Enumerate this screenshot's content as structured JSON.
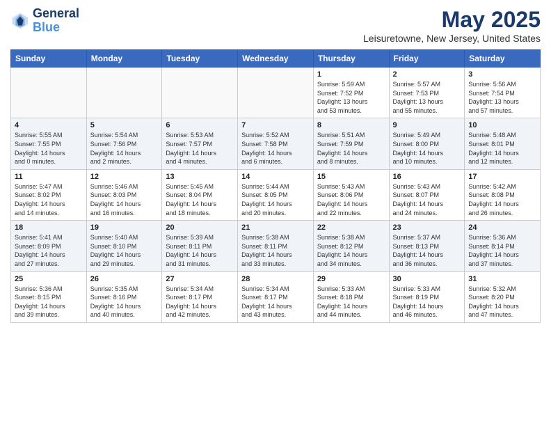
{
  "header": {
    "logo_line1": "General",
    "logo_line2": "Blue",
    "title": "May 2025",
    "subtitle": "Leisuretowne, New Jersey, United States"
  },
  "weekdays": [
    "Sunday",
    "Monday",
    "Tuesday",
    "Wednesday",
    "Thursday",
    "Friday",
    "Saturday"
  ],
  "weeks": [
    [
      {
        "day": "",
        "info": ""
      },
      {
        "day": "",
        "info": ""
      },
      {
        "day": "",
        "info": ""
      },
      {
        "day": "",
        "info": ""
      },
      {
        "day": "1",
        "info": "Sunrise: 5:59 AM\nSunset: 7:52 PM\nDaylight: 13 hours\nand 53 minutes."
      },
      {
        "day": "2",
        "info": "Sunrise: 5:57 AM\nSunset: 7:53 PM\nDaylight: 13 hours\nand 55 minutes."
      },
      {
        "day": "3",
        "info": "Sunrise: 5:56 AM\nSunset: 7:54 PM\nDaylight: 13 hours\nand 57 minutes."
      }
    ],
    [
      {
        "day": "4",
        "info": "Sunrise: 5:55 AM\nSunset: 7:55 PM\nDaylight: 14 hours\nand 0 minutes."
      },
      {
        "day": "5",
        "info": "Sunrise: 5:54 AM\nSunset: 7:56 PM\nDaylight: 14 hours\nand 2 minutes."
      },
      {
        "day": "6",
        "info": "Sunrise: 5:53 AM\nSunset: 7:57 PM\nDaylight: 14 hours\nand 4 minutes."
      },
      {
        "day": "7",
        "info": "Sunrise: 5:52 AM\nSunset: 7:58 PM\nDaylight: 14 hours\nand 6 minutes."
      },
      {
        "day": "8",
        "info": "Sunrise: 5:51 AM\nSunset: 7:59 PM\nDaylight: 14 hours\nand 8 minutes."
      },
      {
        "day": "9",
        "info": "Sunrise: 5:49 AM\nSunset: 8:00 PM\nDaylight: 14 hours\nand 10 minutes."
      },
      {
        "day": "10",
        "info": "Sunrise: 5:48 AM\nSunset: 8:01 PM\nDaylight: 14 hours\nand 12 minutes."
      }
    ],
    [
      {
        "day": "11",
        "info": "Sunrise: 5:47 AM\nSunset: 8:02 PM\nDaylight: 14 hours\nand 14 minutes."
      },
      {
        "day": "12",
        "info": "Sunrise: 5:46 AM\nSunset: 8:03 PM\nDaylight: 14 hours\nand 16 minutes."
      },
      {
        "day": "13",
        "info": "Sunrise: 5:45 AM\nSunset: 8:04 PM\nDaylight: 14 hours\nand 18 minutes."
      },
      {
        "day": "14",
        "info": "Sunrise: 5:44 AM\nSunset: 8:05 PM\nDaylight: 14 hours\nand 20 minutes."
      },
      {
        "day": "15",
        "info": "Sunrise: 5:43 AM\nSunset: 8:06 PM\nDaylight: 14 hours\nand 22 minutes."
      },
      {
        "day": "16",
        "info": "Sunrise: 5:43 AM\nSunset: 8:07 PM\nDaylight: 14 hours\nand 24 minutes."
      },
      {
        "day": "17",
        "info": "Sunrise: 5:42 AM\nSunset: 8:08 PM\nDaylight: 14 hours\nand 26 minutes."
      }
    ],
    [
      {
        "day": "18",
        "info": "Sunrise: 5:41 AM\nSunset: 8:09 PM\nDaylight: 14 hours\nand 27 minutes."
      },
      {
        "day": "19",
        "info": "Sunrise: 5:40 AM\nSunset: 8:10 PM\nDaylight: 14 hours\nand 29 minutes."
      },
      {
        "day": "20",
        "info": "Sunrise: 5:39 AM\nSunset: 8:11 PM\nDaylight: 14 hours\nand 31 minutes."
      },
      {
        "day": "21",
        "info": "Sunrise: 5:38 AM\nSunset: 8:11 PM\nDaylight: 14 hours\nand 33 minutes."
      },
      {
        "day": "22",
        "info": "Sunrise: 5:38 AM\nSunset: 8:12 PM\nDaylight: 14 hours\nand 34 minutes."
      },
      {
        "day": "23",
        "info": "Sunrise: 5:37 AM\nSunset: 8:13 PM\nDaylight: 14 hours\nand 36 minutes."
      },
      {
        "day": "24",
        "info": "Sunrise: 5:36 AM\nSunset: 8:14 PM\nDaylight: 14 hours\nand 37 minutes."
      }
    ],
    [
      {
        "day": "25",
        "info": "Sunrise: 5:36 AM\nSunset: 8:15 PM\nDaylight: 14 hours\nand 39 minutes."
      },
      {
        "day": "26",
        "info": "Sunrise: 5:35 AM\nSunset: 8:16 PM\nDaylight: 14 hours\nand 40 minutes."
      },
      {
        "day": "27",
        "info": "Sunrise: 5:34 AM\nSunset: 8:17 PM\nDaylight: 14 hours\nand 42 minutes."
      },
      {
        "day": "28",
        "info": "Sunrise: 5:34 AM\nSunset: 8:17 PM\nDaylight: 14 hours\nand 43 minutes."
      },
      {
        "day": "29",
        "info": "Sunrise: 5:33 AM\nSunset: 8:18 PM\nDaylight: 14 hours\nand 44 minutes."
      },
      {
        "day": "30",
        "info": "Sunrise: 5:33 AM\nSunset: 8:19 PM\nDaylight: 14 hours\nand 46 minutes."
      },
      {
        "day": "31",
        "info": "Sunrise: 5:32 AM\nSunset: 8:20 PM\nDaylight: 14 hours\nand 47 minutes."
      }
    ]
  ]
}
